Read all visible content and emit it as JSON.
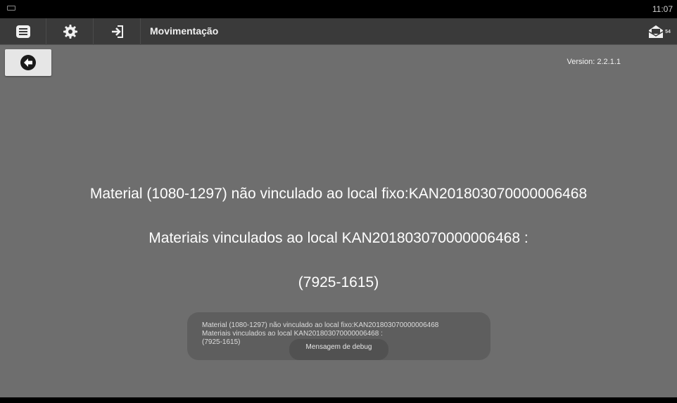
{
  "status_bar": {
    "time": "11:07"
  },
  "action_bar": {
    "title": "Movimentação",
    "mail_badge": "54"
  },
  "content": {
    "version": "Version: 2.2.1.1",
    "message_line1": "Material (1080-1297) não vinculado ao local fixo:KAN201803070000006468",
    "message_line2": "Materiais vinculados ao local KAN201803070000006468 :",
    "message_line3": "(7925-1615)"
  },
  "toast": {
    "line1": "Material (1080-1297) não vinculado ao local fixo:KAN201803070000006468",
    "line2": "Materiais vinculados ao local KAN201803070000006468 :",
    "line3": "(7925-1615)",
    "title": "Mensagem de debug"
  }
}
